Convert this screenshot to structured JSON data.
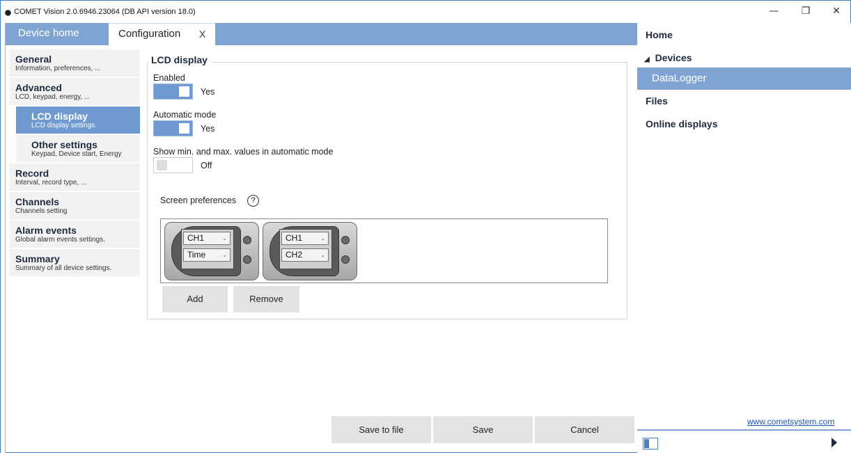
{
  "window": {
    "title": "COMET Vision 2.0.6946.23064 (DB API version 18.0)",
    "minimize_glyph": "—",
    "maximize_glyph": "❐",
    "close_glyph": "✕"
  },
  "tabs": [
    {
      "label": "Device home"
    },
    {
      "label": "Configuration",
      "close": "X"
    }
  ],
  "settings_nav": [
    {
      "title": "General",
      "sub": "Information, preferences, ..."
    },
    {
      "title": "Advanced",
      "sub": "LCD, keypad, energy, ..."
    },
    {
      "title": "LCD display",
      "sub": "LCD display settings."
    },
    {
      "title": "Other settings",
      "sub": "Keypad, Device start, Energy"
    },
    {
      "title": "Record",
      "sub": "Interval, record type, ..."
    },
    {
      "title": "Channels",
      "sub": "Channels setting"
    },
    {
      "title": "Alarm events",
      "sub": "Global alarm events settings."
    },
    {
      "title": "Summary",
      "sub": "Summary of all device settings."
    }
  ],
  "lcd": {
    "section_title": "LCD display",
    "enabled_label": "Enabled",
    "enabled_value": "Yes",
    "auto_label": "Automatic mode",
    "auto_value": "Yes",
    "minmax_label": "Show min. and max. values in automatic mode",
    "minmax_value": "Off",
    "screen_prefs_label": "Screen preferences",
    "help_glyph": "?",
    "screens": [
      {
        "line1": "CH1",
        "line2": "Time"
      },
      {
        "line1": "CH1",
        "line2": "CH2"
      }
    ],
    "add_label": "Add",
    "remove_label": "Remove"
  },
  "actions": {
    "save_to_file": "Save to file",
    "save": "Save",
    "cancel": "Cancel"
  },
  "right_panel": {
    "home": "Home",
    "devices": "Devices",
    "devices_glyph": "◢",
    "datalogger": "DataLogger",
    "files": "Files",
    "online_displays": "Online displays",
    "website": "www.cometsystem.com"
  },
  "colors": {
    "accent": "#6f9ad0",
    "tabbar": "#7fa4d2",
    "link": "#1a56b3"
  }
}
